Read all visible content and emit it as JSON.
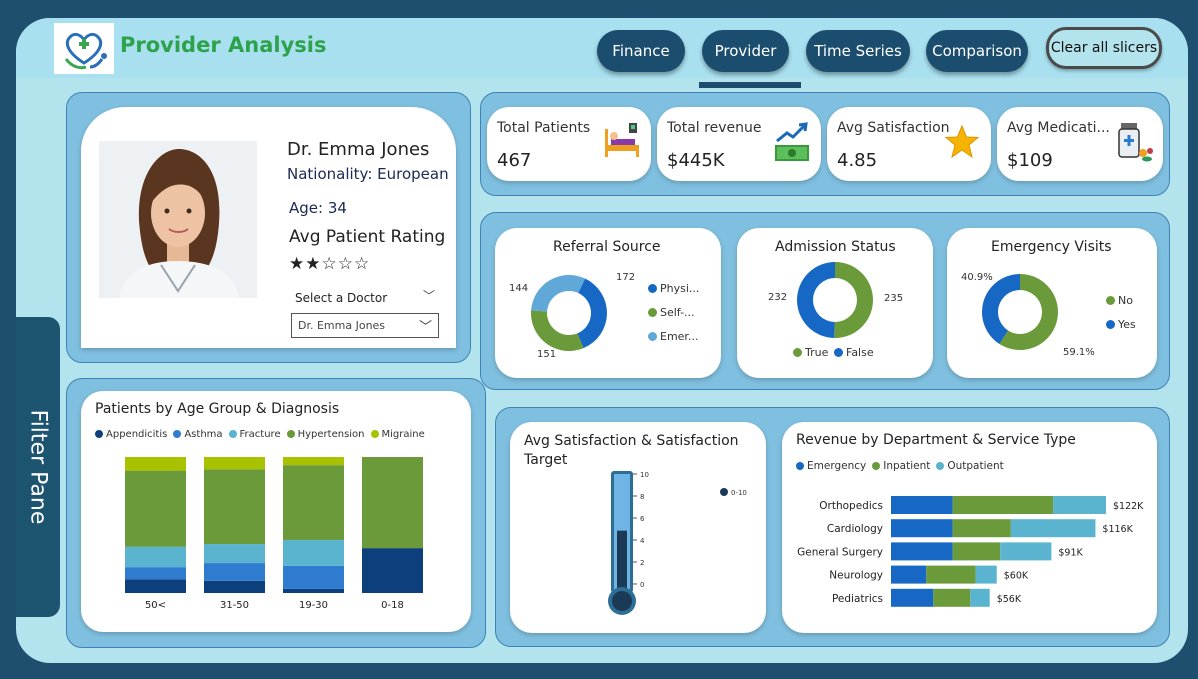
{
  "header": {
    "title": "Provider Analysis",
    "nav": [
      {
        "label": "Finance",
        "active": false
      },
      {
        "label": "Provider",
        "active": true
      },
      {
        "label": "Time Series",
        "active": false
      },
      {
        "label": "Comparison",
        "active": false
      }
    ],
    "clear_label": "Clear all slicers"
  },
  "filter_pane": {
    "label": "Filter Pane"
  },
  "profile": {
    "name": "Dr. Emma Jones",
    "nationality": "Nationality: European",
    "age": "Age: 34",
    "rating_label": "Avg Patient Rating",
    "stars": "★★☆☆☆",
    "rating": 2,
    "select_label": "Select a Doctor",
    "selected_doctor": "Dr. Emma Jones"
  },
  "kpis": [
    {
      "title": "Total Patients",
      "value": "467",
      "icon": "hospital-bed-icon"
    },
    {
      "title": "Total revenue",
      "value": "$445K",
      "icon": "money-growth-icon"
    },
    {
      "title": "Avg Satisfaction",
      "value": "4.85",
      "icon": "star-icon"
    },
    {
      "title": "Avg Medicati...",
      "value": "$109",
      "icon": "medicine-icon"
    }
  ],
  "colors": {
    "dark_navy": "#1b4d6e",
    "title_green": "#2da24b",
    "blue": "#1668c4",
    "green": "#6a9a3a",
    "light_blue": "#5fa8d8",
    "lime": "#a9c200",
    "teal": "#5bb4cf",
    "navy": "#0d3f7d"
  },
  "chart_data": [
    {
      "type": "pie",
      "title": "Referral Source",
      "labels": [
        "Physi...",
        "Self-...",
        "Emer..."
      ],
      "values": [
        172,
        151,
        144
      ],
      "colors": [
        "#1668c4",
        "#6a9a3a",
        "#5fa8d8"
      ]
    },
    {
      "type": "pie",
      "title": "Admission Status",
      "labels": [
        "True",
        "False"
      ],
      "values": [
        235,
        232
      ],
      "colors": [
        "#6a9a3a",
        "#1668c4"
      ]
    },
    {
      "type": "pie",
      "title": "Emergency Visits",
      "labels": [
        "No",
        "Yes"
      ],
      "values": [
        59.1,
        40.9
      ],
      "value_labels": [
        "59.1%",
        "40.9%"
      ],
      "colors": [
        "#6a9a3a",
        "#1668c4"
      ]
    },
    {
      "type": "bar",
      "stacked": "100%",
      "title": "Patients by Age Group & Diagnosis",
      "categories": [
        "50<",
        "31-50",
        "19-30",
        "0-18"
      ],
      "series": [
        {
          "name": "Appendicitis",
          "color": "#0d3f7d",
          "values": [
            10,
            9,
            3,
            33
          ]
        },
        {
          "name": "Asthma",
          "color": "#2f7bd0",
          "values": [
            9,
            13,
            17,
            0
          ]
        },
        {
          "name": "Fracture",
          "color": "#5bb4cf",
          "values": [
            15,
            14,
            19,
            0
          ]
        },
        {
          "name": "Hypertension",
          "color": "#6a9a3a",
          "values": [
            56,
            55,
            55,
            67
          ]
        },
        {
          "name": "Migraine",
          "color": "#a9c200",
          "values": [
            10,
            9,
            6,
            0
          ]
        }
      ]
    },
    {
      "type": "bar",
      "title": "Avg Satisfaction & Satisfaction Target",
      "target_label": "0-10",
      "ylim": [
        0,
        10
      ],
      "ticks": [
        "10",
        "8",
        "6",
        "4",
        "2",
        "0"
      ],
      "value": 4.85,
      "target": 10
    },
    {
      "type": "bar",
      "orientation": "horizontal",
      "stacked": true,
      "title": "Revenue by Department & Service Type",
      "categories": [
        "Orthopedics",
        "Cardiology",
        "General Surgery",
        "Neurology",
        "Pediatrics"
      ],
      "totals": [
        "$122K",
        "$116K",
        "$91K",
        "$60K",
        "$56K"
      ],
      "series": [
        {
          "name": "Emergency",
          "color": "#1668c4",
          "values": [
            35,
            35,
            35,
            20,
            24
          ]
        },
        {
          "name": "Inpatient",
          "color": "#6a9a3a",
          "values": [
            57,
            33,
            27,
            28,
            21
          ]
        },
        {
          "name": "Outpatient",
          "color": "#5bb4cf",
          "values": [
            30,
            48,
            29,
            12,
            11
          ]
        }
      ],
      "xlim": [
        0,
        122
      ]
    }
  ]
}
